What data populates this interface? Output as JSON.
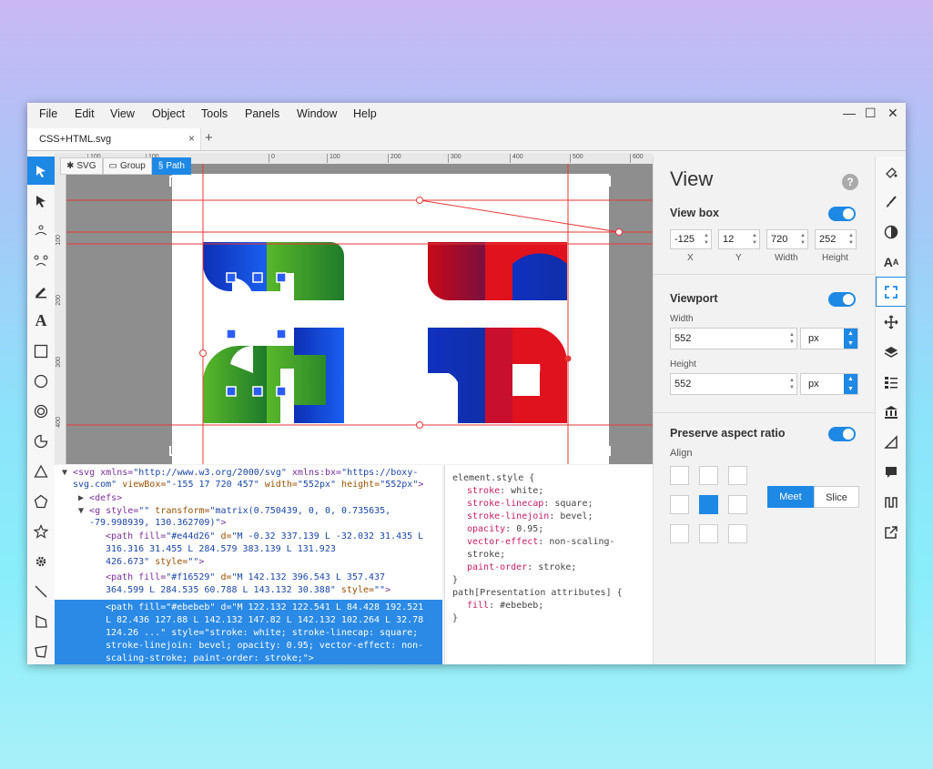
{
  "menu": [
    "File",
    "Edit",
    "View",
    "Object",
    "Tools",
    "Panels",
    "Window",
    "Help"
  ],
  "window_controls": {
    "minimize": "—",
    "maximize": "☐",
    "close": "✕"
  },
  "tab": {
    "title": "CSS+HTML.svg",
    "close": "×",
    "new": "+"
  },
  "breadcrumbs": [
    "SVG",
    "Group",
    "Path"
  ],
  "ruler": {
    "h": [
      "100",
      "0",
      "100",
      "200",
      "300",
      "400",
      "500",
      "600"
    ],
    "v": [
      "100",
      "200",
      "300",
      "400"
    ]
  },
  "code_lines": [
    [
      "<svg xmlns=",
      "\"http://www.w3.org/2000/svg\"",
      " xmlns:bx=",
      "\"https://boxy-"
    ],
    [
      "svg.com\"",
      " viewBox=",
      "\"-155 17 720 457\"",
      " width=",
      "\"552px\"",
      " height=",
      "\"552px\"",
      ">"
    ],
    [
      "<defs>"
    ],
    [
      "<g style=",
      "\"\"",
      " transform=",
      "\"matrix(0.750439, 0, 0, 0.735635,"
    ],
    [
      "-79.998939, 130.362709)\"",
      ">"
    ],
    [
      "<path fill=",
      "\"#e44d26\"",
      " d=",
      "\"M -0.32 337.139 L -32.032 31.435 L"
    ],
    [
      "316.316 31.455 L 284.579 383.139 L 131.923"
    ],
    [
      "426.673\"",
      " style=",
      "\"\"",
      ">"
    ],
    [
      "<path fill=",
      "\"#f16529\"",
      " d=",
      "\"M 142.132 396.543 L 357.437"
    ],
    [
      "364.599 L 284.535 60.788 L 143.132 30.388\"",
      " style=",
      "\"\"",
      ">"
    ]
  ],
  "code_selected": [
    "<path fill=\"#ebebeb\" d=\"M 122.132 122.541 L 84.428 192.521",
    "L 82.436 127.88 L 142.132 147.82 L 142.132 102.264 L 32.78",
    "124.26 ...\" style=\"stroke: white; stroke-linecap: square;",
    "stroke-linejoin: bevel; opacity: 0.95; vector-effect: non-",
    "scaling-stroke; paint-order: stroke;\">"
  ],
  "css_rules": {
    "selector1": "element.style {",
    "props1": [
      [
        "stroke",
        "white"
      ],
      [
        "stroke-linecap",
        "square"
      ],
      [
        "stroke-linejoin",
        "bevel"
      ],
      [
        "opacity",
        "0.95"
      ],
      [
        "vector-effect",
        "non-scaling-"
      ],
      [
        "",
        "stroke"
      ],
      [
        "paint-order",
        "stroke"
      ]
    ],
    "close": "}",
    "selector2": "path[Presentation attributes] {",
    "props2": [
      [
        "fill",
        "#ebebeb"
      ]
    ]
  },
  "panel": {
    "title": "View",
    "help": "?",
    "viewbox": {
      "label": "View box",
      "enabled": true,
      "x": "-125",
      "y": "12",
      "w": "720",
      "h": "252",
      "lx": "X",
      "ly": "Y",
      "lw": "Width",
      "lh": "Height"
    },
    "viewport": {
      "label": "Viewport",
      "enabled": true,
      "width_label": "Width",
      "width": "552",
      "width_unit": "px",
      "height_label": "Height",
      "height": "552",
      "height_unit": "px"
    },
    "aspect": {
      "label": "Preserve aspect ratio",
      "enabled": true,
      "align_label": "Align",
      "meet": "Meet",
      "slice": "Slice",
      "selected": "Meet"
    }
  },
  "colors": {
    "accent": "#1e88e5",
    "guide": "#e53935",
    "blue": "#1034c8",
    "green": "#3aa52a",
    "red": "#e0121e"
  }
}
